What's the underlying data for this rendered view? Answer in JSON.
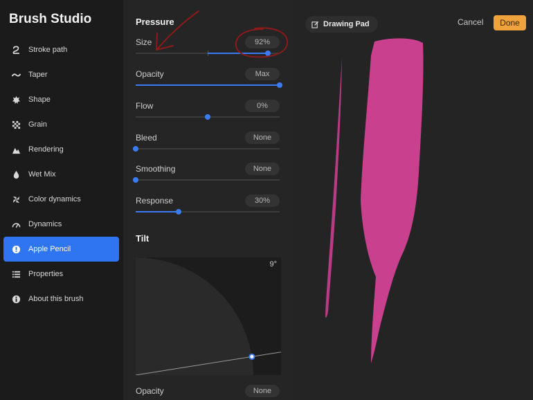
{
  "sidebar": {
    "title": "Brush Studio",
    "items": [
      {
        "label": "Stroke path",
        "icon": "stroke-path-icon"
      },
      {
        "label": "Taper",
        "icon": "taper-icon"
      },
      {
        "label": "Shape",
        "icon": "shape-icon"
      },
      {
        "label": "Grain",
        "icon": "grain-icon"
      },
      {
        "label": "Rendering",
        "icon": "rendering-icon"
      },
      {
        "label": "Wet Mix",
        "icon": "wet-mix-icon"
      },
      {
        "label": "Color dynamics",
        "icon": "color-dynamics-icon"
      },
      {
        "label": "Dynamics",
        "icon": "dynamics-icon"
      },
      {
        "label": "Apple Pencil",
        "icon": "apple-pencil-icon",
        "active": true
      },
      {
        "label": "Properties",
        "icon": "properties-icon"
      },
      {
        "label": "About this brush",
        "icon": "info-icon"
      }
    ]
  },
  "pressure": {
    "title": "Pressure",
    "size": {
      "label": "Size",
      "value": "92%",
      "level": 0.92
    },
    "opacity": {
      "label": "Opacity",
      "value": "Max",
      "level": 1.0
    },
    "flow": {
      "label": "Flow",
      "value": "0%",
      "level": 0.5
    },
    "bleed": {
      "label": "Bleed",
      "value": "None",
      "level": 0.0
    },
    "smoothing": {
      "label": "Smoothing",
      "value": "None",
      "level": 0.0
    },
    "response": {
      "label": "Response",
      "value": "30%",
      "level": 0.3
    }
  },
  "tilt": {
    "title": "Tilt",
    "angle_readout": "9°",
    "angle_degrees": 9,
    "opacity": {
      "label": "Opacity",
      "value": "None"
    }
  },
  "drawing_pad": {
    "label": "Drawing Pad",
    "cancel_label": "Cancel",
    "done_label": "Done"
  },
  "colors": {
    "accent": "#3b7cf6",
    "done": "#f0a33c",
    "stroke": "#c8408e",
    "annotation": "#8b1a1a"
  }
}
